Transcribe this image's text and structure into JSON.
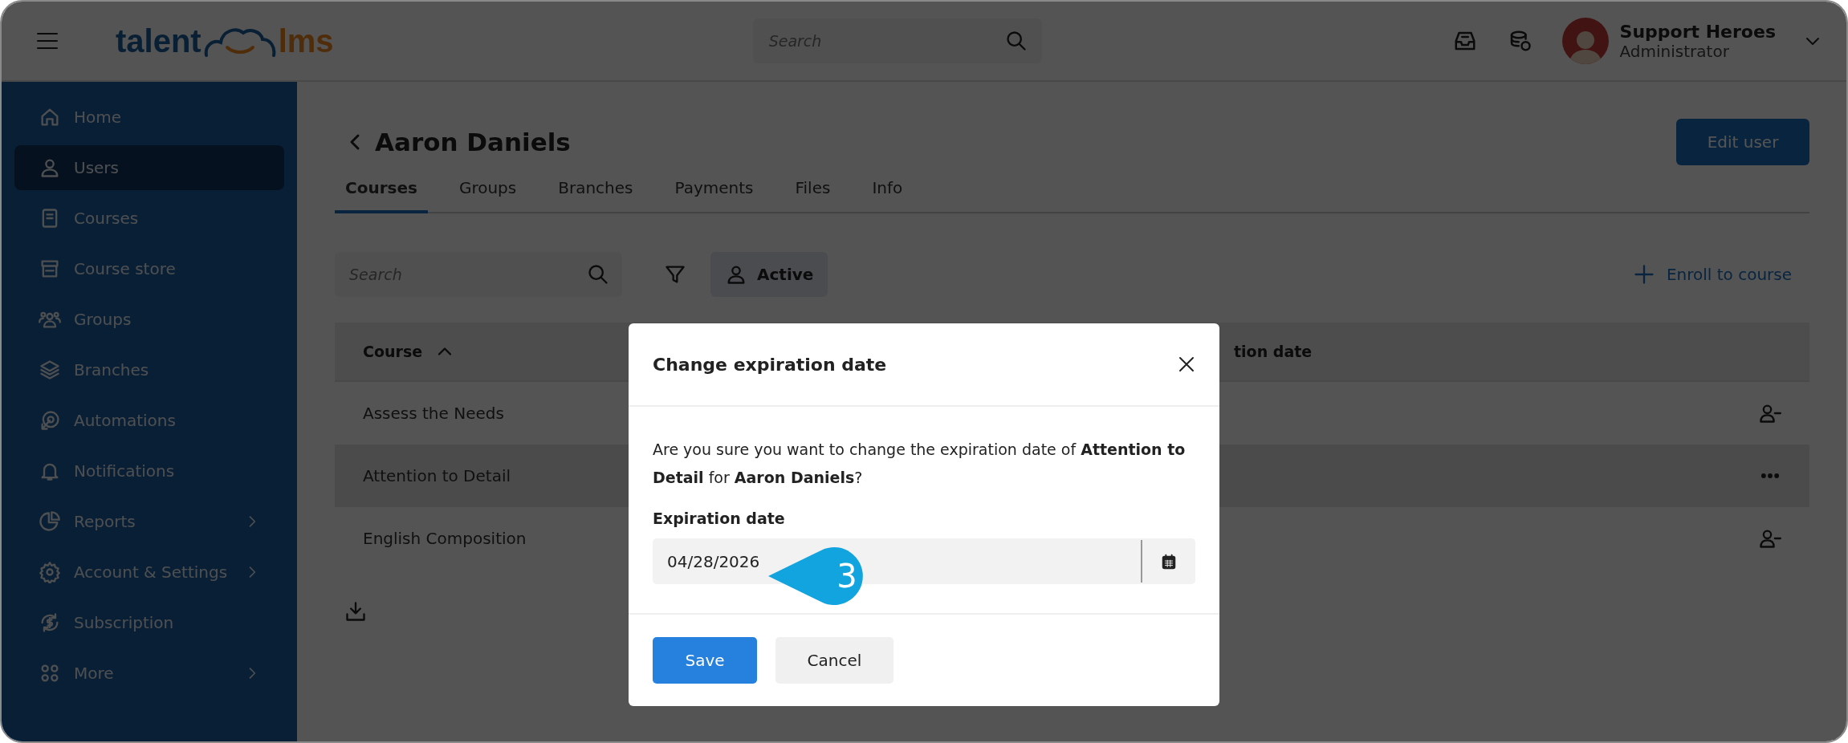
{
  "topbar": {
    "logo": [
      "talent",
      "lms"
    ],
    "search": {
      "placeholder": "Search"
    },
    "user": {
      "name": "Support Heroes",
      "role": "Administrator"
    }
  },
  "sidebar": {
    "items": [
      {
        "label": "Home",
        "selected": false,
        "has_submenu": false
      },
      {
        "label": "Users",
        "selected": true,
        "has_submenu": false
      },
      {
        "label": "Courses",
        "selected": false,
        "has_submenu": false
      },
      {
        "label": "Course store",
        "selected": false,
        "has_submenu": false
      },
      {
        "label": "Groups",
        "selected": false,
        "has_submenu": false
      },
      {
        "label": "Branches",
        "selected": false,
        "has_submenu": false
      },
      {
        "label": "Automations",
        "selected": false,
        "has_submenu": false
      },
      {
        "label": "Notifications",
        "selected": false,
        "has_submenu": false
      },
      {
        "label": "Reports",
        "selected": false,
        "has_submenu": true
      },
      {
        "label": "Account & Settings",
        "selected": false,
        "has_submenu": true
      },
      {
        "label": "Subscription",
        "selected": false,
        "has_submenu": false
      },
      {
        "label": "More",
        "selected": false,
        "has_submenu": true
      }
    ]
  },
  "page": {
    "title": "Aaron Daniels",
    "edit_button": "Edit user",
    "tabs": [
      {
        "label": "Courses",
        "selected": true
      },
      {
        "label": "Groups",
        "selected": false
      },
      {
        "label": "Branches",
        "selected": false
      },
      {
        "label": "Payments",
        "selected": false
      },
      {
        "label": "Files",
        "selected": false
      },
      {
        "label": "Info",
        "selected": false
      }
    ],
    "search": {
      "placeholder": "Search"
    },
    "status_filter": "Active",
    "enroll_link": "Enroll to course"
  },
  "table": {
    "columns": [
      "Course",
      "tion date"
    ],
    "sorted_ascending": true,
    "rows": [
      {
        "course": "Assess the Needs",
        "kind": "unenroll"
      },
      {
        "course": "Attention to Detail",
        "kind": "menu"
      },
      {
        "course": "English Composition",
        "kind": "unenroll"
      }
    ]
  },
  "dialog": {
    "title": "Change expiration date",
    "message": "Are you sure you want to change the expiration date of **Attention to Detail** for **Aaron Daniels**?",
    "field_label": "Expiration date",
    "value": "04/28/2026",
    "buttons": [
      {
        "label": "Save",
        "kind": "primary"
      },
      {
        "label": "Cancel",
        "kind": "secondary"
      }
    ]
  },
  "callout": {
    "number": "3"
  }
}
